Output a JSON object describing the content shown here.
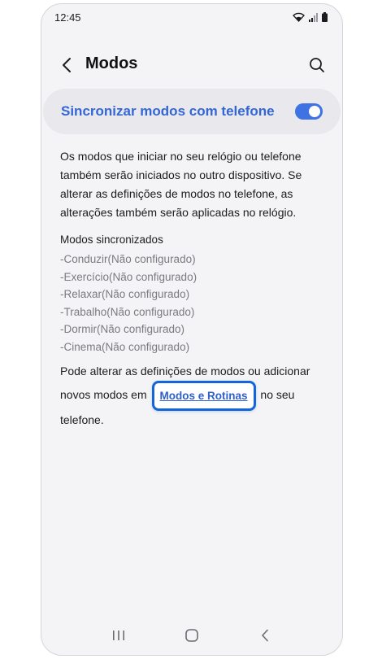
{
  "status_bar": {
    "time": "12:45",
    "icons": [
      "wifi-icon",
      "signal-icon",
      "battery-icon"
    ]
  },
  "header": {
    "title": "Modos",
    "back_icon": "chevron-left-icon",
    "search_icon": "search-icon"
  },
  "sync": {
    "label": "Sincronizar modos com telefone",
    "enabled": true,
    "accent_color": "#3f72e2"
  },
  "description": "Os modos que iniciar no seu relógio ou telefone também serão iniciados no outro dispositivo. Se alterar as definições de modos no telefone, as alterações também serão aplicadas no relógio.",
  "synced_modes": {
    "title": "Modos sincronizados",
    "items": [
      "-Conduzir(Não configurado)",
      "-Exercício(Não configurado)",
      "-Relaxar(Não configurado)",
      "-Trabalho(Não configurado)",
      "-Dormir(Não configurado)",
      "-Cinema(Não configurado)"
    ]
  },
  "footer": {
    "text_before": "Pode alterar as definições de modos ou adicionar novos modos em",
    "link_label": "Modos e Rotinas",
    "text_after": "no seu telefone."
  },
  "nav_bar": {
    "icons": [
      "recent-apps-icon",
      "home-icon",
      "back-icon"
    ]
  }
}
